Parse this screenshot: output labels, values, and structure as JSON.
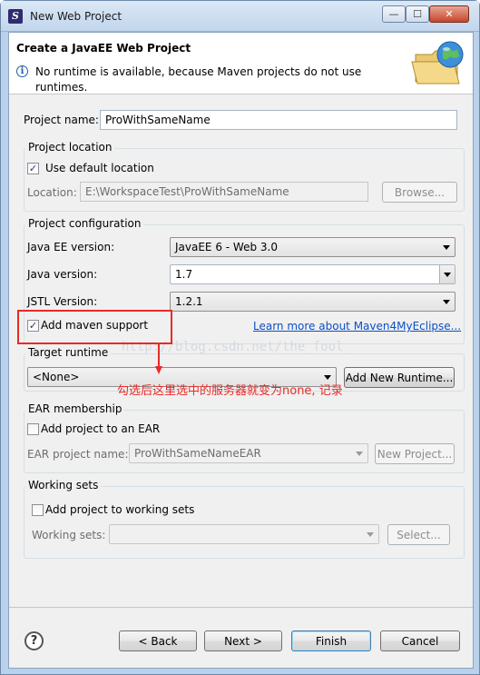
{
  "window": {
    "title": "New Web Project",
    "minimize_glyph": "—",
    "maximize_glyph": "☐",
    "close_glyph": "✕"
  },
  "header": {
    "title": "Create a JavaEE Web Project",
    "message": "No runtime is available, because Maven projects do not use runtimes.",
    "info_glyph": "i"
  },
  "project_name": {
    "label": "Project name:",
    "value": "ProWithSameName"
  },
  "project_location": {
    "group_title": "Project location",
    "use_default_label": "Use default location",
    "use_default_checked": true,
    "location_label": "Location:",
    "location_value": "E:\\WorkspaceTest\\ProWithSameName",
    "browse_label": "Browse..."
  },
  "project_configuration": {
    "group_title": "Project configuration",
    "javaee_label": "Java EE version:",
    "javaee_value": "JavaEE 6 - Web 3.0",
    "java_label": "Java version:",
    "java_value": "1.7",
    "jstl_label": "JSTL Version:",
    "jstl_value": "1.2.1",
    "maven_label": "Add maven support",
    "maven_checked": true,
    "learn_more_link": "Learn more about Maven4MyEclipse..."
  },
  "target_runtime": {
    "group_title": "Target runtime",
    "value": "<None>",
    "new_runtime_label": "Add New Runtime..."
  },
  "ear_membership": {
    "group_title": "EAR membership",
    "add_label": "Add project to an EAR",
    "add_checked": false,
    "project_name_label": "EAR project name:",
    "project_name_value": "ProWithSameNameEAR",
    "new_project_label": "New Project..."
  },
  "working_sets": {
    "group_title": "Working sets",
    "add_label": "Add project to working sets",
    "add_checked": false,
    "sets_label": "Working sets:",
    "sets_value": "",
    "select_label": "Select..."
  },
  "footer": {
    "help_glyph": "?",
    "back_label": "< Back",
    "next_label": "Next >",
    "finish_label": "Finish",
    "cancel_label": "Cancel"
  },
  "annotation": {
    "note": "勾选后这里选中的服务器就变为none, 记录",
    "watermark": "http://blog.csdn.net/the_fool_",
    "color": "#e82a26"
  },
  "colors": {
    "title_bar": "#c2d6ec",
    "dialog_bg": "#f0f0f0",
    "link": "#0a4fc8"
  }
}
